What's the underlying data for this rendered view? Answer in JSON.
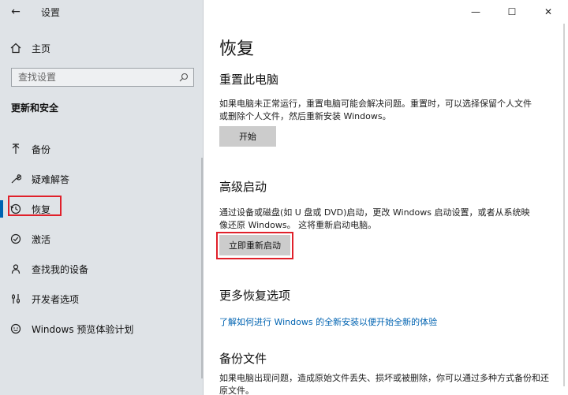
{
  "window": {
    "title": "设置",
    "back_glyph": "←",
    "min_glyph": "—",
    "max_glyph": "☐",
    "close_glyph": "✕"
  },
  "sidebar": {
    "home_label": "主页",
    "search_placeholder": "查找设置",
    "section_heading": "更新和安全",
    "items": [
      {
        "label": "备份",
        "icon": "backup-arrow-icon"
      },
      {
        "label": "疑难解答",
        "icon": "wrench-icon"
      },
      {
        "label": "恢复",
        "icon": "history-clock-icon",
        "active": true
      },
      {
        "label": "激活",
        "icon": "check-circle-icon"
      },
      {
        "label": "查找我的设备",
        "icon": "person-pin-icon"
      },
      {
        "label": "开发者选项",
        "icon": "sliders-icon"
      },
      {
        "label": "Windows 预览体验计划",
        "icon": "smiley-icon"
      }
    ]
  },
  "main": {
    "page_title": "恢复",
    "reset": {
      "title": "重置此电脑",
      "description": "如果电脑未正常运行，重置电脑可能会解决问题。重置时，可以选择保留个人文件或删除个人文件，然后重新安装 Windows。",
      "button": "开始"
    },
    "advanced": {
      "title": "高级启动",
      "description": "通过设备或磁盘(如 U 盘或 DVD)启动，更改 Windows 启动设置，或者从系统映像还原 Windows。 这将重新启动电脑。",
      "button": "立即重新启动"
    },
    "more": {
      "title": "更多恢复选项",
      "link": "了解如何进行 Windows 的全新安装以便开始全新的体验"
    },
    "backup": {
      "title": "备份文件",
      "description": "如果电脑出现问题，造成原始文件丢失、损坏或被删除，你可以通过多种方式备份和还原文件。"
    }
  },
  "colors": {
    "accent": "#0063b1",
    "highlight": "#e0202a",
    "sidebar_bg": "#dfe3e7"
  }
}
